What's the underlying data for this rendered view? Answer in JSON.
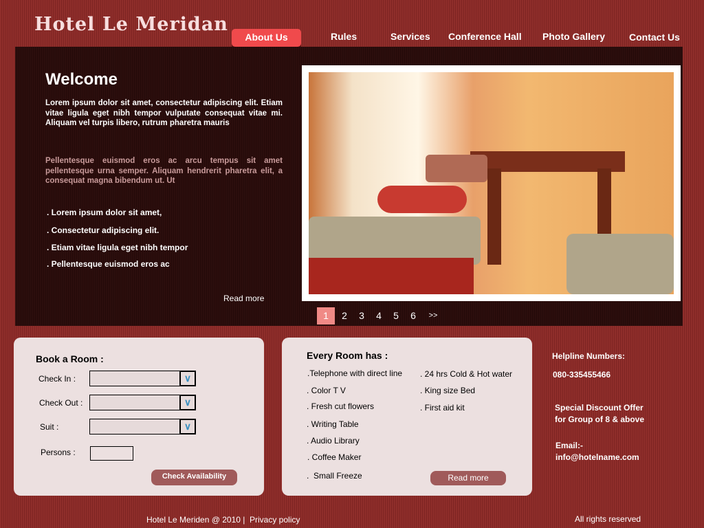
{
  "logo": "Hotel Le Meridan",
  "nav": [
    "About Us",
    "Rules",
    "Services",
    "Conference Hall",
    "Photo Gallery",
    "Contact Us"
  ],
  "welcome": {
    "title": "Welcome",
    "para1": "Lorem ipsum dolor sit amet, consectetur adipiscing elit. Etiam vitae ligula eget nibh tempor vulputate consequat vitae mi. Aliquam vel turpis libero, rutrum pharetra mauris",
    "para2": "Pellentesque euismod eros ac arcu tempus sit amet pellentesque urna semper. Aliquam hendrerit pharetra elit, a consequat magna bibendum ut. Ut",
    "bullets": [
      ". Lorem ipsum dolor sit amet,",
      ". Consectetur adipiscing elit.",
      ". Etiam vitae ligula eget nibh tempor",
      ". Pellentesque euismod eros ac"
    ],
    "read_more": "Read more"
  },
  "pagination": {
    "pages": [
      "1",
      "2",
      "3",
      "4",
      "5",
      "6",
      ">>"
    ],
    "current": "1"
  },
  "booking": {
    "title": "Book a Room :",
    "check_in": "Check In :",
    "check_out": "Check Out :",
    "suit": "Suit :",
    "persons": "Persons :",
    "button": "Check Availability"
  },
  "features": {
    "title": "Every Room has :",
    "left": [
      ".Telephone with direct line",
      ". Color T V",
      ". Fresh cut flowers",
      ". Writing Table",
      ". Audio Library",
      ". Coffee Maker",
      ".  Small Freeze"
    ],
    "right": [
      ". 24 hrs Cold & Hot water",
      ". King size Bed",
      ". First aid kit"
    ],
    "read_more": "Read more"
  },
  "sidebar": {
    "helpline_label": "Helpline Numbers:",
    "helpline": "080-335455466",
    "offer1": "Special Discount Offer",
    "offer2": "for Group of 8 & above",
    "email_label": "Email:-",
    "email": "info@hotelname.com"
  },
  "footer": {
    "copyright": "Hotel Le Meriden @ 2010 |",
    "privacy": "Privacy policy",
    "rights": "All rights reserved"
  },
  "colors": {
    "background": "#8a2a28",
    "panel": "#2a0d0c",
    "active_nav": "#f04a4c",
    "button": "#a05a5a",
    "card": "#ece0e0"
  }
}
